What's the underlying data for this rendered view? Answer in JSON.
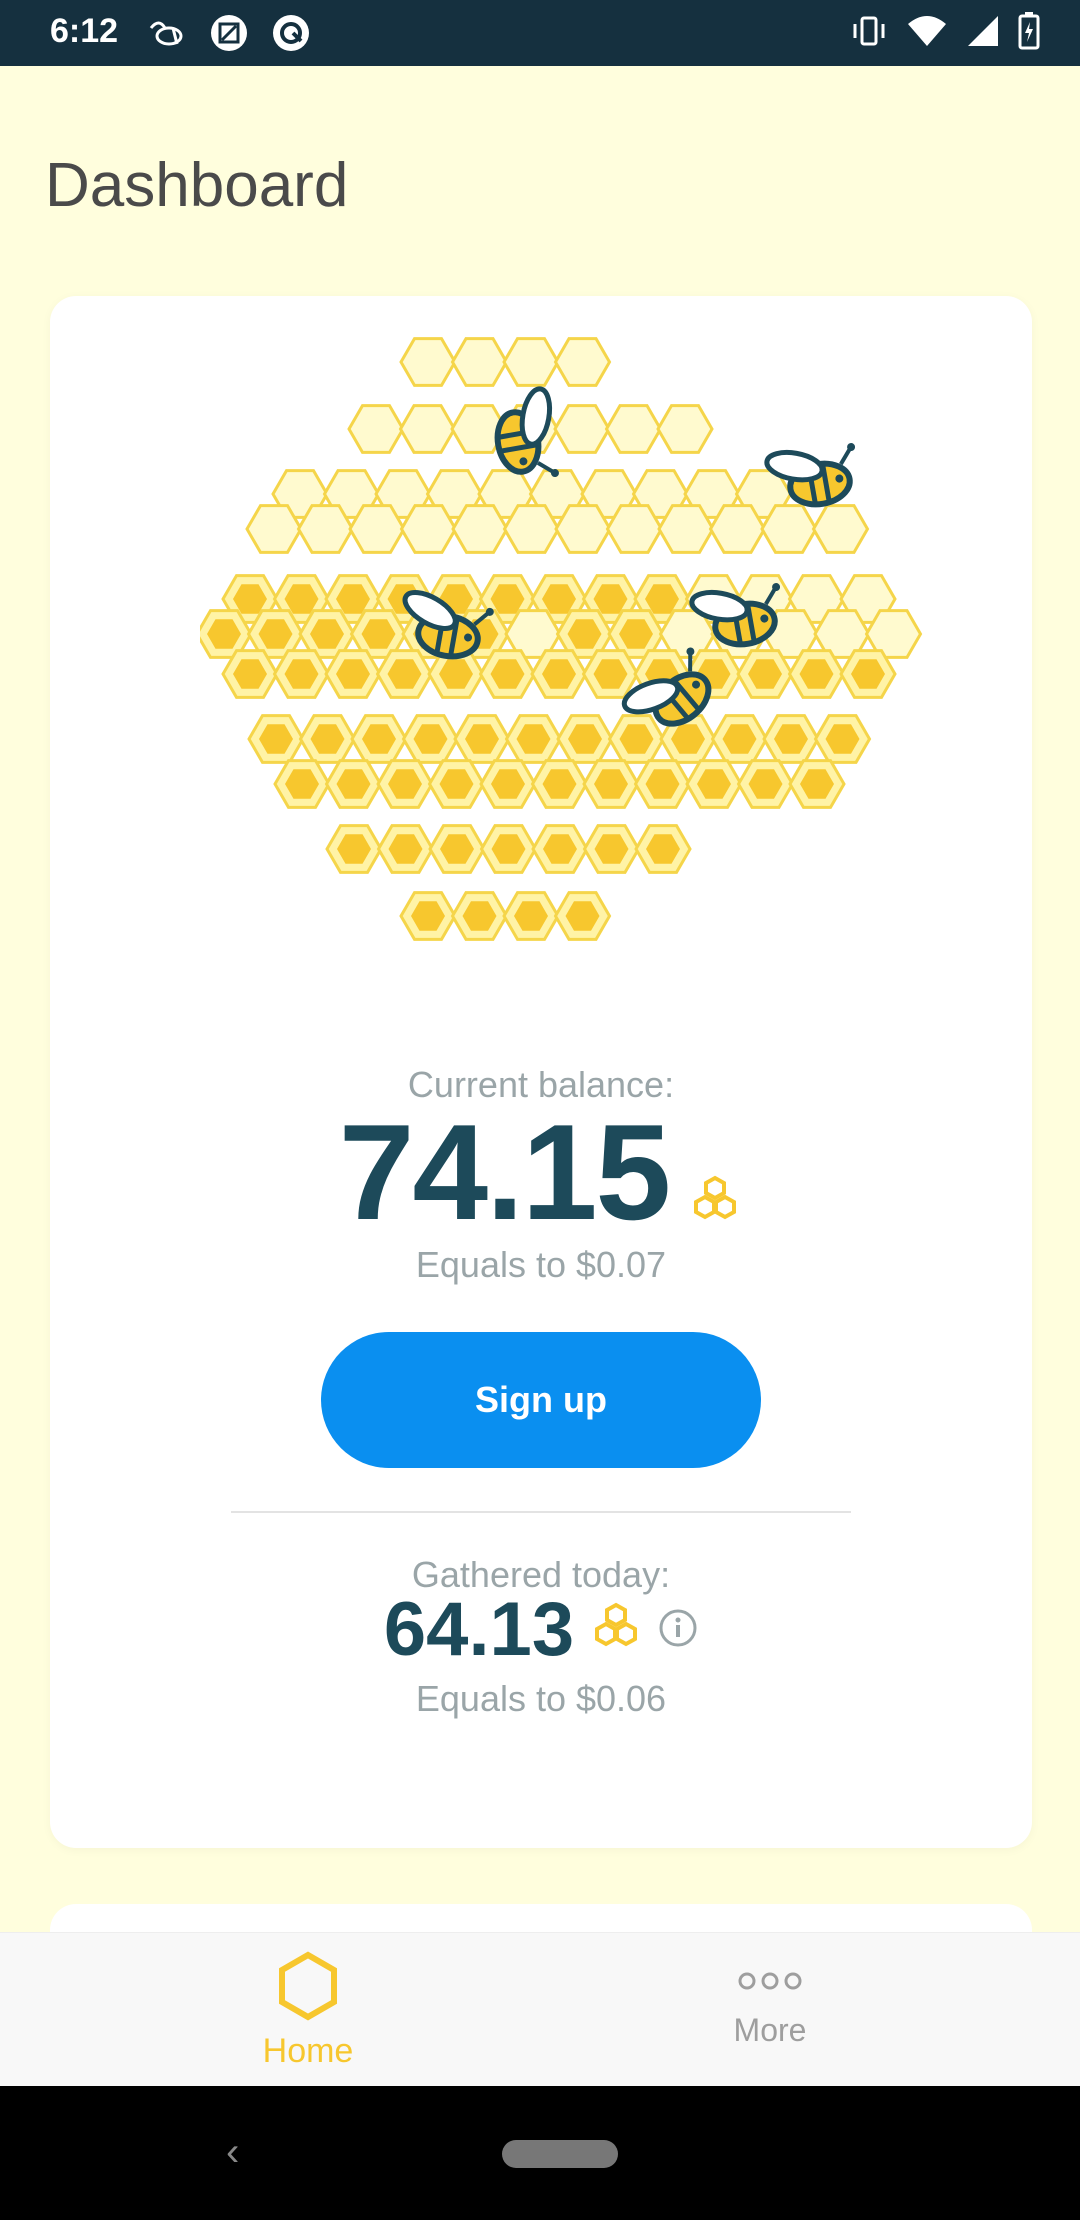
{
  "status_bar": {
    "time": "6:12",
    "icons_left": [
      "bee-notification-icon",
      "image-icon",
      "sync-icon"
    ],
    "icons_right": [
      "vibrate-icon",
      "wifi-icon",
      "signal-icon",
      "battery-charging-icon"
    ]
  },
  "page": {
    "title": "Dashboard"
  },
  "balance": {
    "label": "Current balance:",
    "value": "74.15",
    "equals": "Equals to $0.07"
  },
  "signup_button": {
    "label": "Sign up"
  },
  "gathered": {
    "label": "Gathered today:",
    "value": "64.13",
    "equals": "Equals to $0.06"
  },
  "bottom_nav": {
    "items": [
      {
        "label": "Home",
        "icon": "hexagon-icon",
        "active": true
      },
      {
        "label": "More",
        "icon": "more-dots-icon",
        "active": false
      }
    ]
  },
  "colors": {
    "background": "#fffedd",
    "honey": "#f7c72e",
    "honey_light": "#fffacf",
    "dark_teal": "#1d4a5a",
    "button_blue": "#0a8ff0",
    "status_bar": "#15303f"
  }
}
